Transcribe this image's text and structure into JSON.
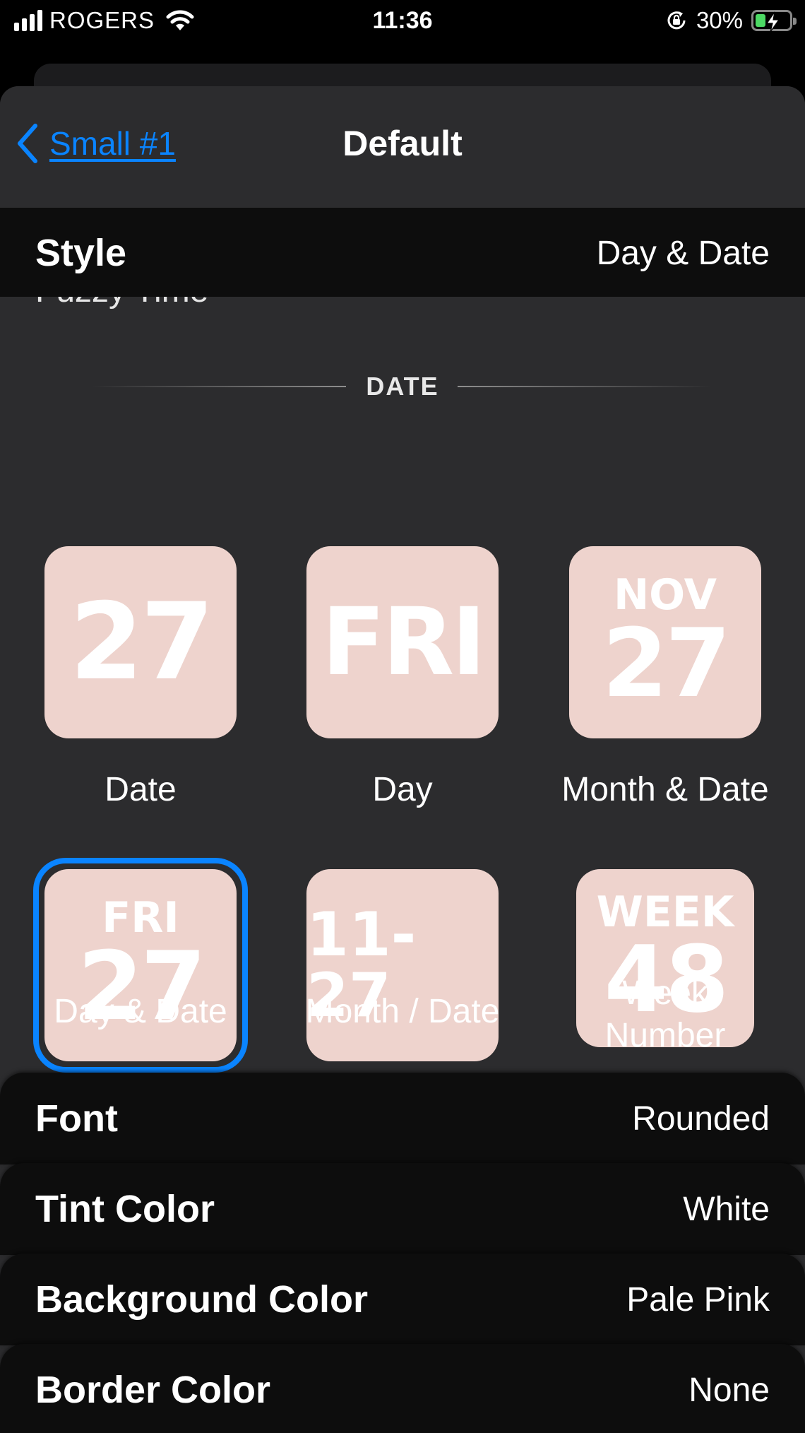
{
  "status": {
    "carrier": "ROGERS",
    "time": "11:36",
    "battery": "30%"
  },
  "nav": {
    "back_label": "Small #1",
    "title": "Default"
  },
  "style_row": {
    "label": "Style",
    "value": "Day & Date"
  },
  "picker": {
    "partial_label": "Fuzzy Time",
    "section": "DATE",
    "tiles": [
      {
        "lines": [
          "27"
        ],
        "caption": "Date"
      },
      {
        "lines": [
          "FRI"
        ],
        "caption": "Day"
      },
      {
        "lines": [
          "NOV",
          "27"
        ],
        "caption": "Month & Date"
      },
      {
        "lines": [
          "FRI",
          "27"
        ],
        "caption": "Day & Date",
        "selected": true
      },
      {
        "lines": [
          "11-27"
        ],
        "caption": "Month / Date"
      },
      {
        "lines": [
          "WEEK",
          "48"
        ],
        "caption": "Week Number"
      }
    ]
  },
  "settings": [
    {
      "label": "Font",
      "value": "Rounded"
    },
    {
      "label": "Tint Color",
      "value": "White"
    },
    {
      "label": "Background Color",
      "value": "Pale Pink"
    },
    {
      "label": "Border Color",
      "value": "None"
    }
  ],
  "colors": {
    "accent": "#0a84ff",
    "tile_background": "#eed3cd",
    "sheet": "#2c2c2e",
    "row": "#0d0d0d"
  },
  "icons": [
    "signal-icon",
    "wifi-icon",
    "orientation-lock-icon",
    "battery-charging-icon",
    "chevron-left-icon"
  ]
}
